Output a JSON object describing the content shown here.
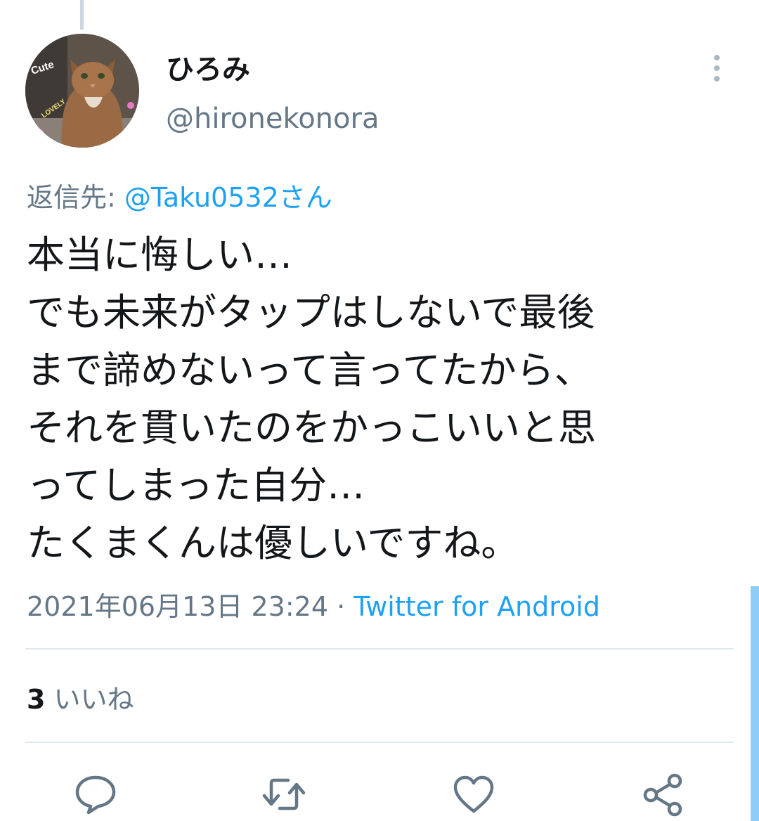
{
  "tweet": {
    "display_name": "ひろみ",
    "handle": "@hironekonora",
    "reply_to_label": "返信先:",
    "reply_to_mention": "@Taku0532さん",
    "text": "本当に悔しい…\nでも未来がタップはしないで最後\nまで諦めないって言ってたから、\nそれを貫いたのをかっこいいと思\nってしまった自分…\nたくまくんは優しいですね。",
    "date": "2021年06月13日 23:24",
    "separator": "·",
    "source": "Twitter for Android",
    "likes_count": "3",
    "likes_label": "いいね"
  },
  "avatar": {
    "stickers": [
      "Cute",
      "LOVELY"
    ]
  },
  "actions": {
    "icons": [
      "reply-icon",
      "retweet-icon",
      "like-icon",
      "share-icon"
    ]
  },
  "colors": {
    "text": "#14171a",
    "secondary": "#657786",
    "accent": "#1da1f2",
    "divider": "#e1e8ed"
  }
}
